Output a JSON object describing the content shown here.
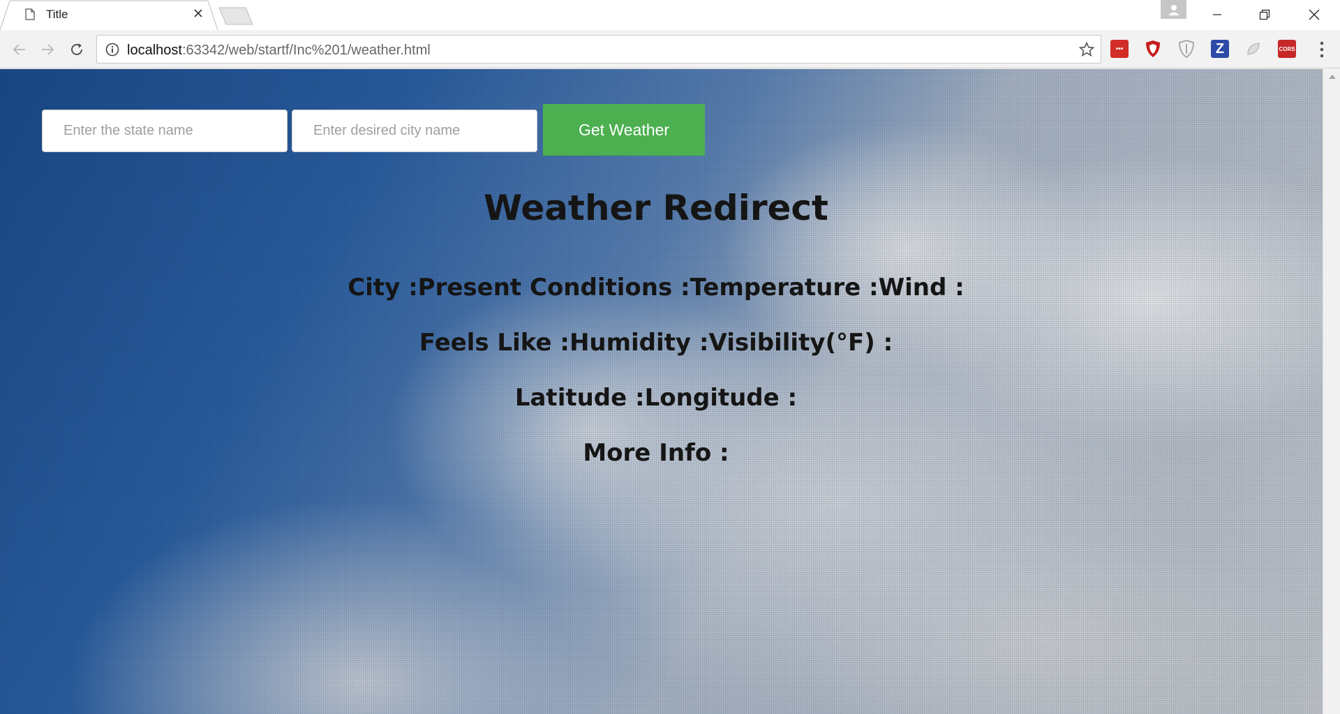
{
  "browser": {
    "tab_title": "Title",
    "url_host": "localhost",
    "url_rest": ":63342/web/startf/Inc%201/weather.html",
    "extensions": [
      {
        "name": "lastpass-icon",
        "label": "•••",
        "color": "#d32d27"
      },
      {
        "name": "ublock-icon",
        "label": "",
        "color": "#c81d1d"
      },
      {
        "name": "shield-icon",
        "label": "",
        "color": "#b0b0b0"
      },
      {
        "name": "zotero-icon",
        "label": "Z",
        "color": "#2e4aa8"
      },
      {
        "name": "extension-icon",
        "label": "",
        "color": "#c8c8c8"
      },
      {
        "name": "cors-icon",
        "label": "CORS",
        "color": "#c62828"
      }
    ]
  },
  "page": {
    "state_placeholder": "Enter the state name",
    "city_placeholder": "Enter desired city name",
    "button_label": "Get Weather",
    "heading": "Weather Redirect",
    "lines": [
      "City :Present Conditions :Temperature :Wind :",
      "Feels Like :Humidity :Visibility(°F) :",
      "Latitude :Longitude :",
      "More Info :"
    ],
    "button_color": "#4caf50"
  }
}
